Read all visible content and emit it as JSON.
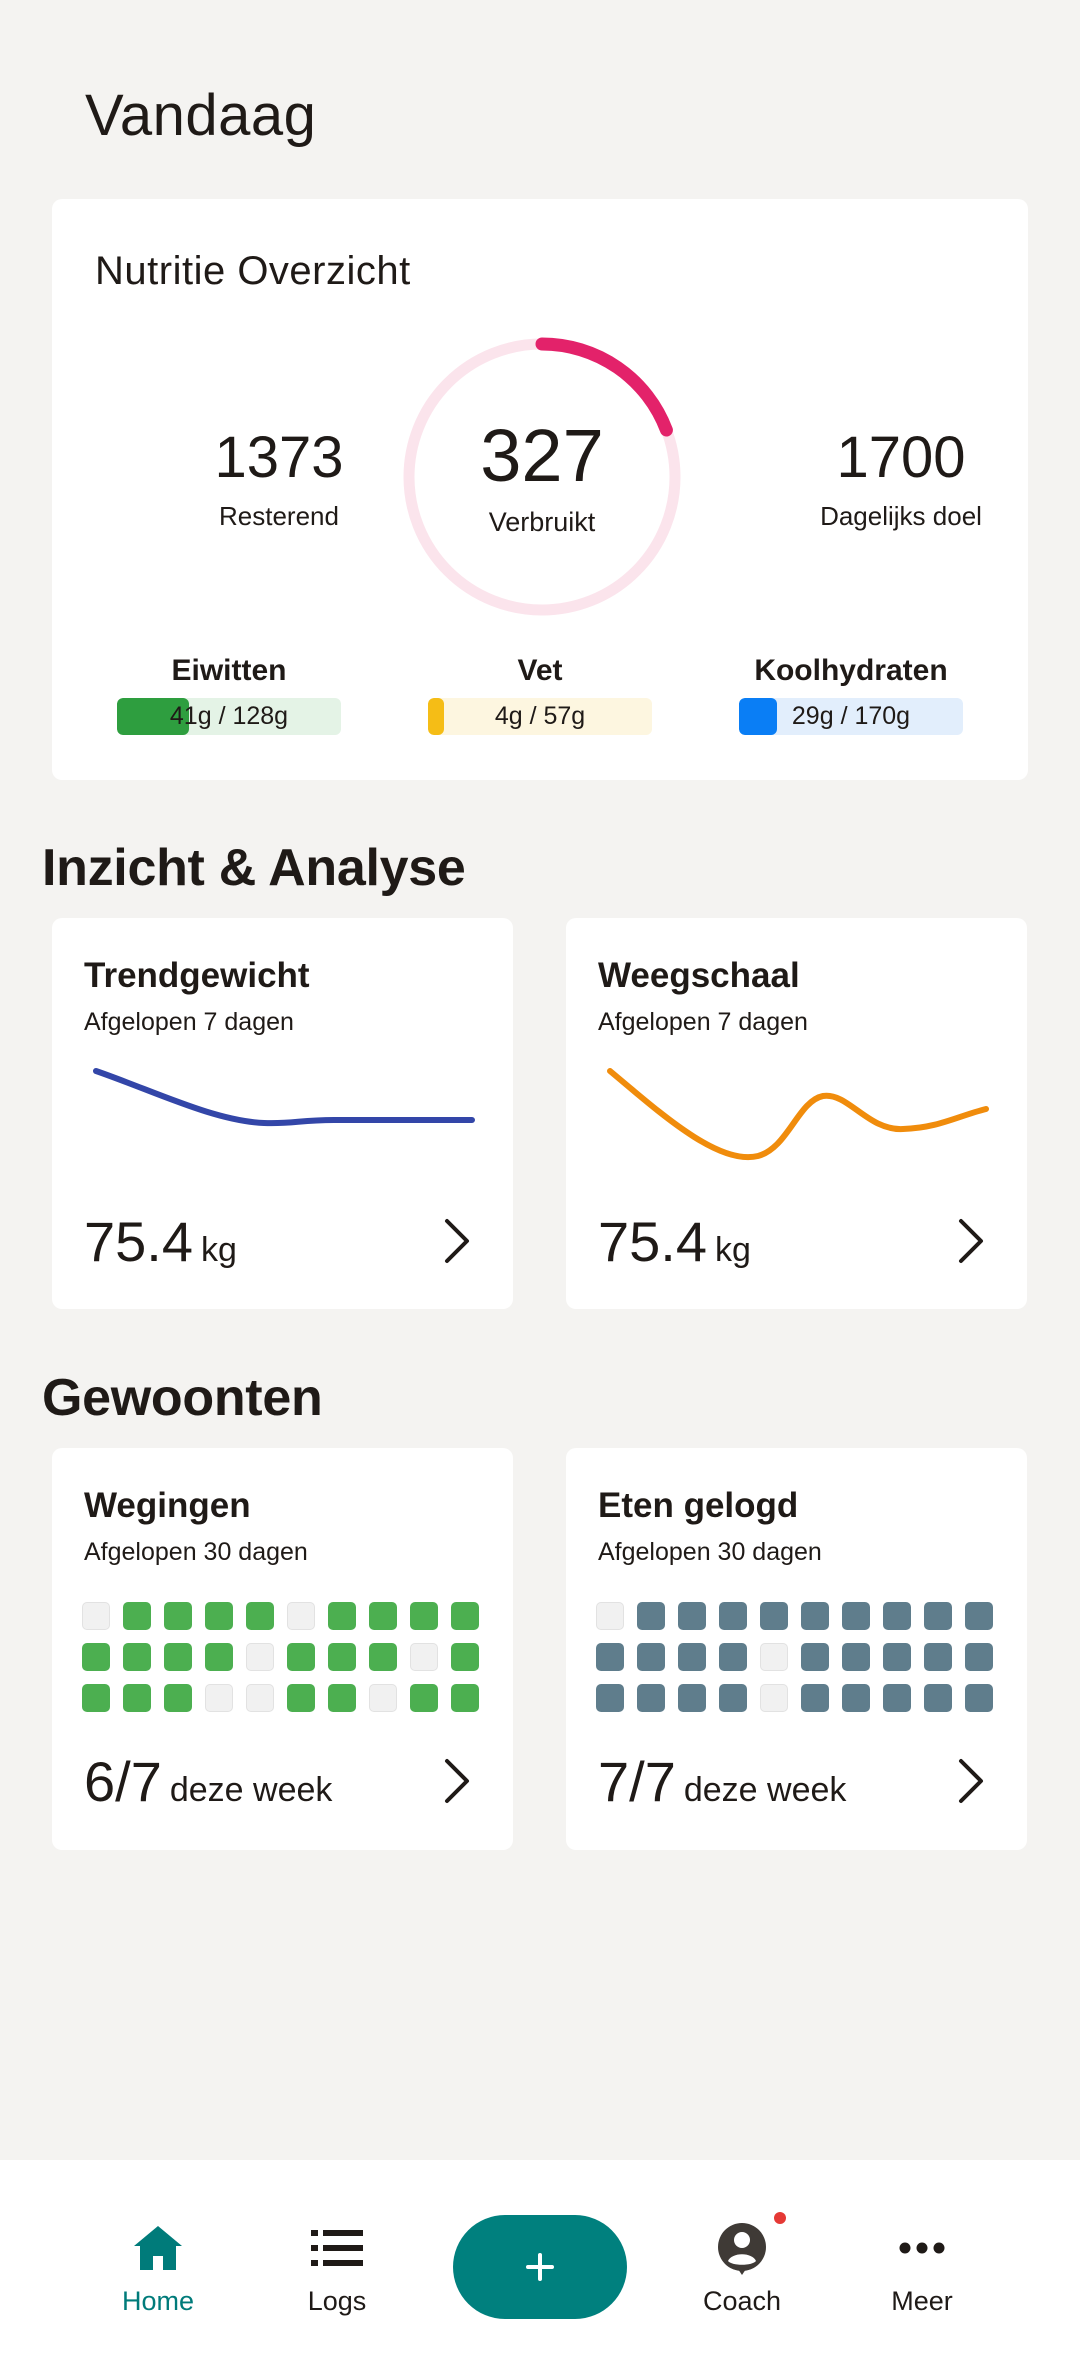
{
  "page": {
    "title": "Vandaag"
  },
  "nutrition": {
    "title": "Nutritie Overzicht",
    "remaining": {
      "value": "1373",
      "label": "Resterend"
    },
    "consumed": {
      "value": "327",
      "label": "Verbruikt",
      "fraction": 0.1924
    },
    "goal": {
      "value": "1700",
      "label": "Dagelijks doel"
    },
    "macros": [
      {
        "name": "Eiwitten",
        "text": "41g / 128g",
        "fraction": 0.32,
        "color": "#2e9e3f",
        "track": "#e4f3e6"
      },
      {
        "name": "Vet",
        "text": "4g / 57g",
        "fraction": 0.07,
        "color": "#f5bd16",
        "track": "#fdf6e0"
      },
      {
        "name": "Koolhydraten",
        "text": "29g / 170g",
        "fraction": 0.17,
        "color": "#0a7ef5",
        "track": "#e2eefc"
      }
    ],
    "ring_color": "#e3226a",
    "ring_track": "#fbe4ec"
  },
  "insight": {
    "title": "Inzicht & Analyse",
    "trend": {
      "title": "Trendgewicht",
      "subtitle": "Afgelopen 7 dagen",
      "value": "75.4",
      "unit": "kg",
      "color": "#3346a8"
    },
    "scale": {
      "title": "Weegschaal",
      "subtitle": "Afgelopen 7 dagen",
      "value": "75.4",
      "unit": "kg",
      "color": "#f08c0c"
    }
  },
  "habits": {
    "title": "Gewoonten",
    "weighings": {
      "title": "Wegingen",
      "subtitle": "Afgelopen 30 dagen",
      "value": "6/7",
      "suffix": "deze week",
      "color": "#4caf50",
      "days": [
        0,
        1,
        1,
        1,
        1,
        0,
        1,
        1,
        1,
        1,
        1,
        1,
        1,
        1,
        0,
        1,
        1,
        1,
        0,
        1,
        1,
        1,
        1,
        0,
        0,
        1,
        1,
        0,
        1,
        1
      ]
    },
    "food": {
      "title": "Eten gelogd",
      "subtitle": "Afgelopen 30 dagen",
      "value": "7/7",
      "suffix": "deze week",
      "color": "#5f7d8c",
      "days": [
        0,
        1,
        1,
        1,
        1,
        1,
        1,
        1,
        1,
        1,
        1,
        1,
        1,
        1,
        0,
        1,
        1,
        1,
        1,
        1,
        1,
        1,
        1,
        1,
        0,
        1,
        1,
        1,
        1,
        1
      ]
    }
  },
  "nav": {
    "home": "Home",
    "logs": "Logs",
    "coach": "Coach",
    "more": "Meer",
    "active_color": "#007b7a",
    "fab_icon": "plus-icon"
  }
}
